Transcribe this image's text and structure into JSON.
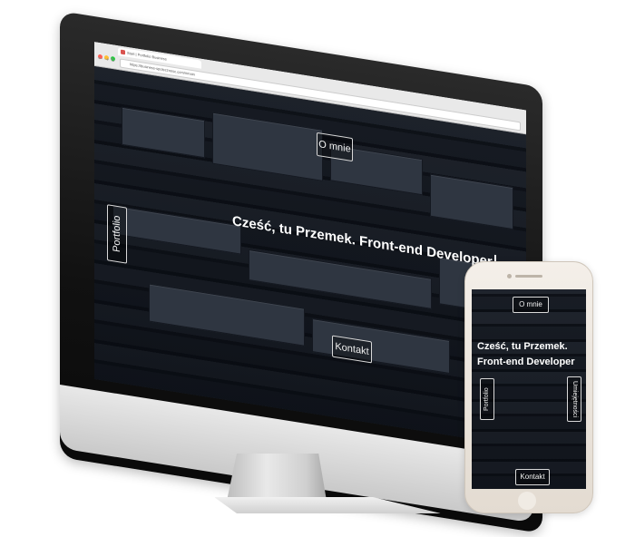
{
  "desktop": {
    "browser": {
      "tab_title": "Start | Portfolio Business",
      "url": "https://business-spolecznosc.com/#main"
    },
    "site": {
      "nav_about": "O mnie",
      "nav_portfolio": "Portfolio",
      "nav_contact": "Kontakt",
      "headline": "Cześć, tu Przemek. Front-end Developer"
    }
  },
  "mobile": {
    "site": {
      "nav_about": "O mnie",
      "nav_portfolio": "Portfolio",
      "nav_skills": "Umiejętności",
      "nav_contact": "Kontakt",
      "headline_line1": "Cześć, tu Przemek.",
      "headline_line2": "Front-end Developer"
    }
  },
  "colors": {
    "site_bg": "#0d0f13",
    "button_border": "#d9d9d9",
    "phone_gold": "#e3dbd1"
  }
}
